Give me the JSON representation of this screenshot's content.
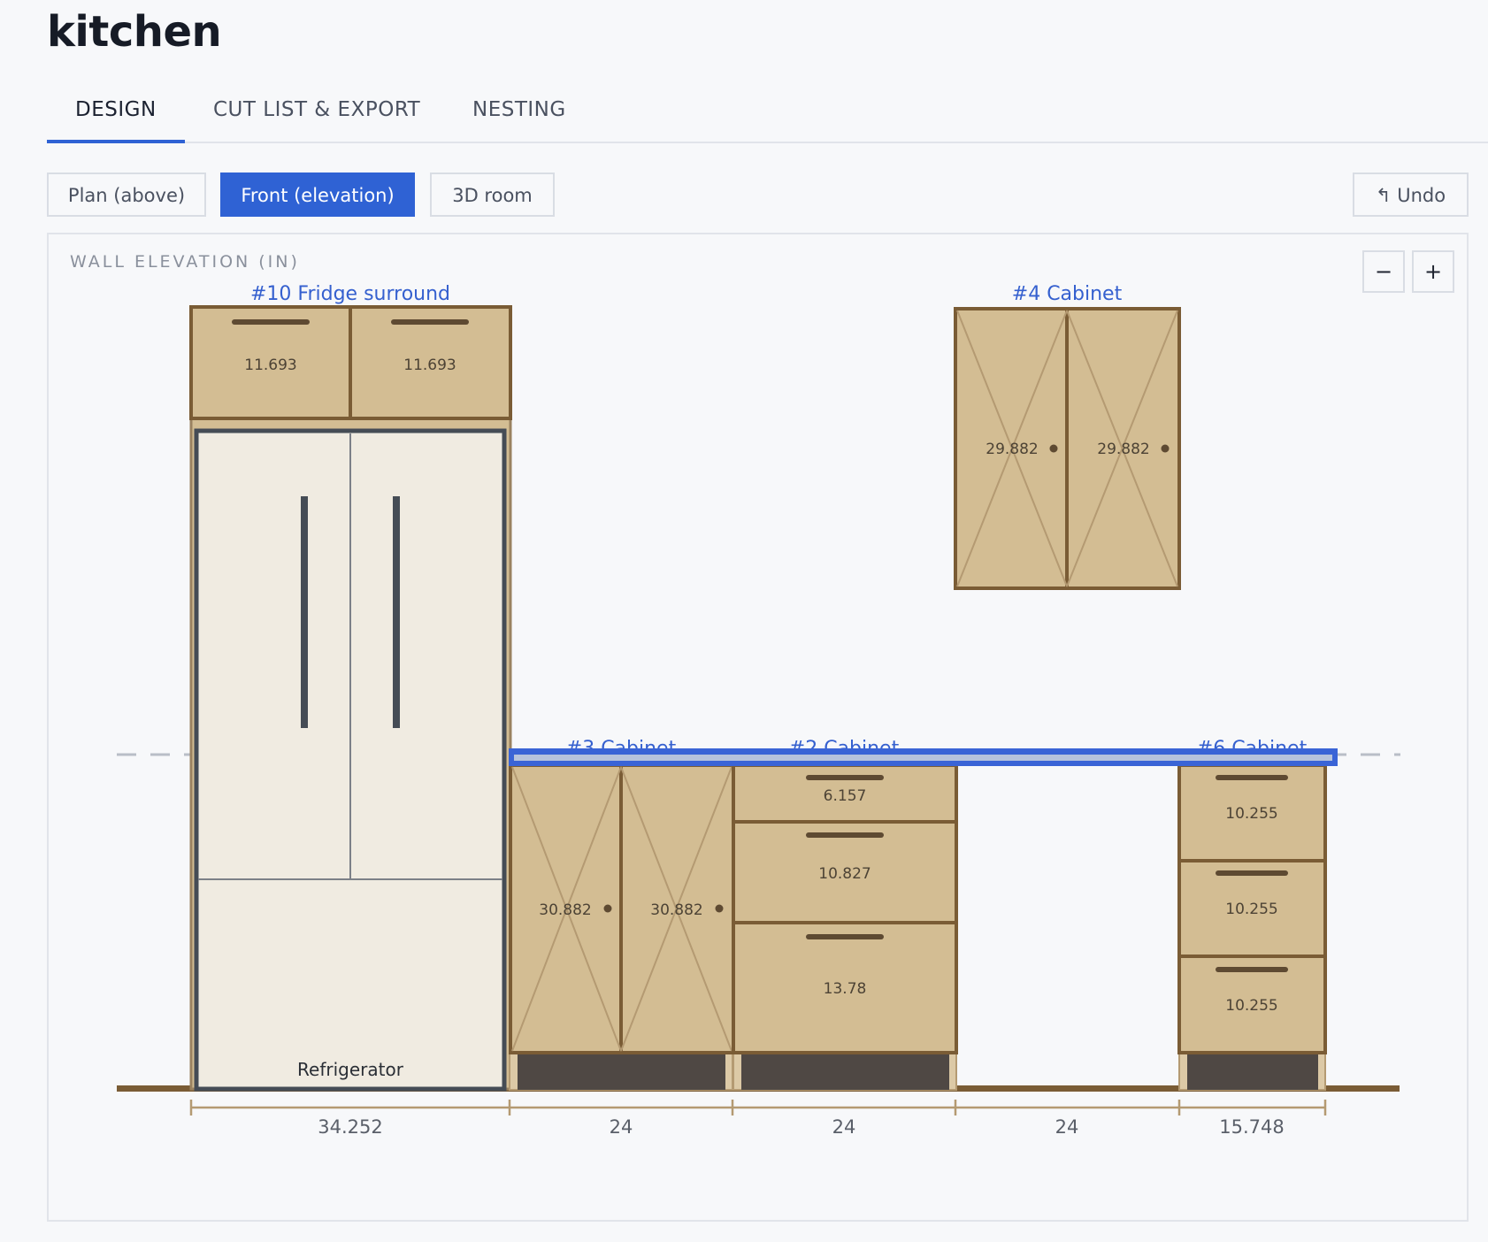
{
  "page": {
    "title": "kitchen"
  },
  "tabs": [
    {
      "label": "DESIGN"
    },
    {
      "label": "CUT LIST & EXPORT"
    },
    {
      "label": "NESTING"
    }
  ],
  "view_buttons": [
    {
      "label": "Plan (above)"
    },
    {
      "label": "Front (elevation)"
    },
    {
      "label": "3D room"
    }
  ],
  "undo": {
    "icon": "undo-icon",
    "glyph": "↰",
    "label": "Undo"
  },
  "canvas": {
    "label": "WALL ELEVATION (IN)",
    "zoom_out": "−",
    "zoom_in": "+"
  },
  "elevation": {
    "units": "IN",
    "fridge_surround": {
      "label": "#10 Fridge surround",
      "top_drawers": [
        "11.693",
        "11.693"
      ],
      "appliance_label": "Refrigerator"
    },
    "upper_cabinet": {
      "label": "#4 Cabinet",
      "doors": [
        "29.882",
        "29.882"
      ]
    },
    "base_cabinets": [
      {
        "label": "#3 Cabinet",
        "doors": [
          "30.882",
          "30.882"
        ]
      },
      {
        "label": "#2 Cabinet",
        "drawers": [
          "6.157",
          "10.827",
          "13.78"
        ]
      },
      {
        "label": "#6 Cabinet",
        "drawers": [
          "10.255",
          "10.255",
          "10.255"
        ]
      }
    ],
    "dimensions": [
      "34.252",
      "24",
      "24",
      "24",
      "15.748"
    ]
  },
  "colors": {
    "accent": "#2f62d4",
    "cabinet_fill": "#d3bd93",
    "cabinet_stroke": "#7a5c35",
    "fridge_fill": "#f0ebe1",
    "fridge_stroke": "#454c55",
    "toe_kick": "#4f4844",
    "countertop": "#3a64d6"
  }
}
